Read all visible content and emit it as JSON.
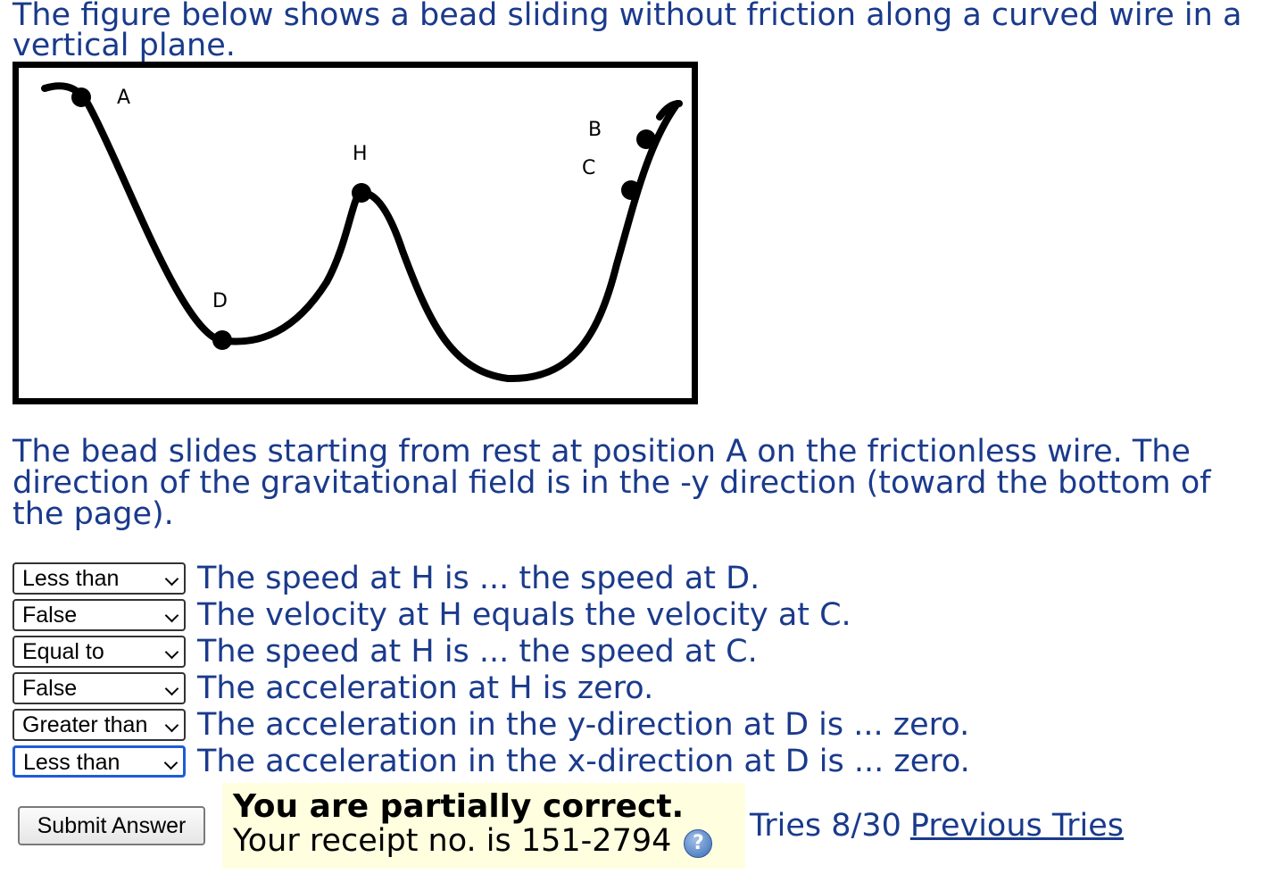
{
  "intro_text": "The figure below shows a bead sliding without friction along a curved wire in a vertical plane.",
  "figure": {
    "labels": {
      "A": "A",
      "B": "B",
      "C": "C",
      "D": "D",
      "H": "H"
    }
  },
  "description": "The bead slides starting from rest at position A on the frictionless wire. The direction of the gravitational field is in the -y direction (toward the bottom of the page).",
  "questions": [
    {
      "selected": "Less than",
      "text": "The speed at H is ... the speed at D."
    },
    {
      "selected": "False",
      "text": "The velocity at H equals the velocity at C."
    },
    {
      "selected": "Equal to",
      "text": "The speed at H is ... the speed at C."
    },
    {
      "selected": "False",
      "text": "The acceleration at H is zero."
    },
    {
      "selected": "Greater than",
      "text": "The acceleration in the y-direction at D is ... zero."
    },
    {
      "selected": "Less than",
      "text": "The acceleration in the x-direction at D is ... zero."
    }
  ],
  "submit_label": "Submit Answer",
  "feedback": {
    "title": "You are partially correct.",
    "receipt": "Your receipt no. is 151-2794",
    "help_icon": "question-circle-icon"
  },
  "tries": "Tries 8/30",
  "previous_tries_link": "Previous Tries"
}
